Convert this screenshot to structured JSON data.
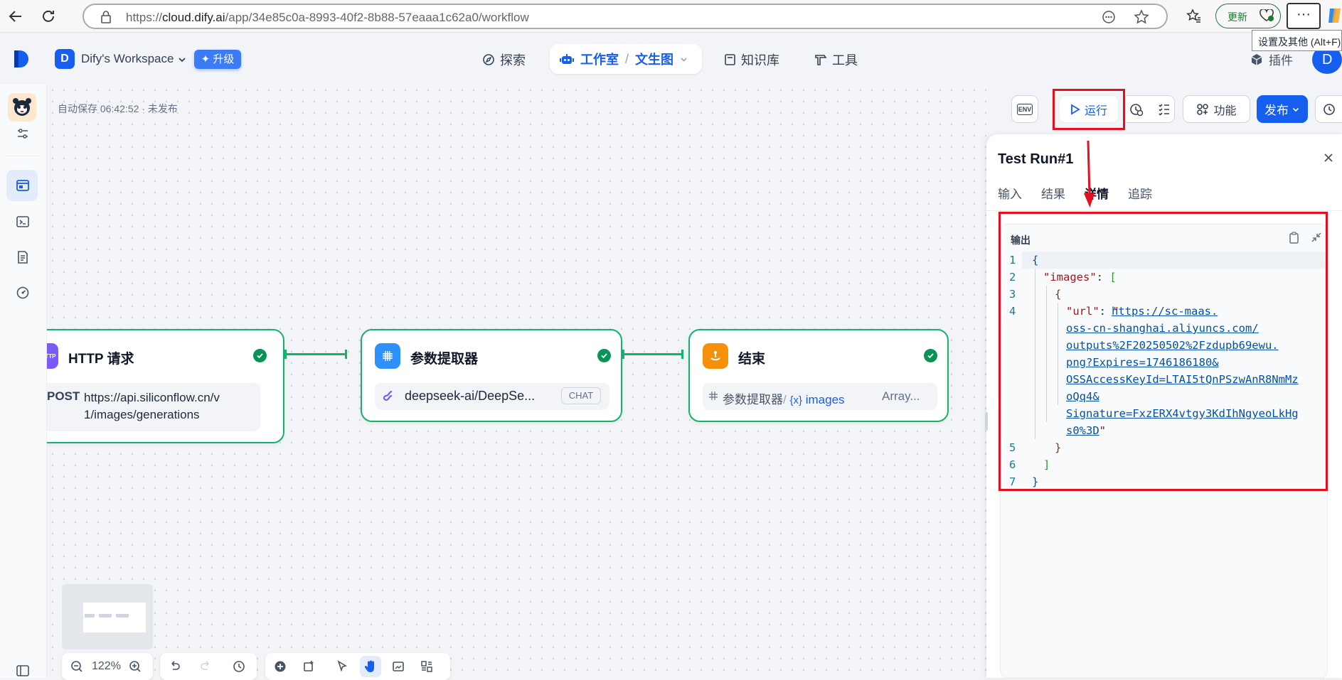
{
  "browser": {
    "url_prefix": "https://",
    "url_host": "cloud.dify.ai",
    "url_path": "/app/34e85c0a-8993-40f2-8b88-57eaaa1c62a0/workflow",
    "update_label": "更新",
    "more_label": "···",
    "tooltip": "设置及其他 (Alt+F)"
  },
  "header": {
    "workspace_initial": "D",
    "workspace_name": "Dify's Workspace",
    "upgrade_label": "升级",
    "nav": {
      "explore": "探索",
      "studio": "工作室",
      "app_name": "文生图",
      "knowledge": "知识库",
      "tools": "工具",
      "plugins": "插件"
    },
    "avatar_initial": "D"
  },
  "workflow": {
    "autosave": "自动保存 06:42:52 · 未发布",
    "toolbar": {
      "env": "ENV",
      "run": "运行",
      "features": "功能",
      "publish": "发布"
    },
    "nodes": {
      "http": {
        "icon_text": "HTTP",
        "title": "HTTP 请求",
        "method": "POST",
        "url_line1": "https://api.siliconflow.cn/v",
        "url_line2": "1/images/generations"
      },
      "extractor": {
        "title": "参数提取器",
        "model": "deepseek-ai/DeepSe...",
        "model_badge": "CHAT"
      },
      "end": {
        "title": "结束",
        "var_node": "参数提取器",
        "var_sep": "/",
        "var_prefix": "{x}",
        "var_name": "images",
        "var_type": "Array..."
      }
    },
    "zoom": "122%"
  },
  "panel": {
    "title": "Test Run#1",
    "tabs": [
      "输入",
      "结果",
      "详情",
      "追踪"
    ],
    "output_label": "输出",
    "code": {
      "line_numbers": [
        "1",
        "2",
        "3",
        "4",
        "5",
        "6",
        "7"
      ],
      "open_brace": "{",
      "key_images": "\"images\"",
      "colon": ": ",
      "open_bracket": "[",
      "inner_open": "{",
      "key_url": "\"url\"",
      "quote_open": "\"",
      "url_lines": [
        "https://sc-maas.",
        "oss-cn-shanghai.aliyuncs.com/",
        "outputs%2F20250502%2Fzdupb69ewu.",
        "png?Expires=1746186180&",
        "OSSAccessKeyId=LTAI5tQnPSzwAnR8NmMz",
        "oQq4&",
        "Signature=FxzERX4vtgy3KdIhNgyeoLkHg",
        "s0%3D"
      ],
      "quote_close": "\"",
      "inner_close": "}",
      "close_bracket": "]",
      "close_brace": "}"
    }
  },
  "colors": {
    "primary": "#155eef",
    "success": "#17b26a",
    "annotation_red": "#e3101f"
  }
}
